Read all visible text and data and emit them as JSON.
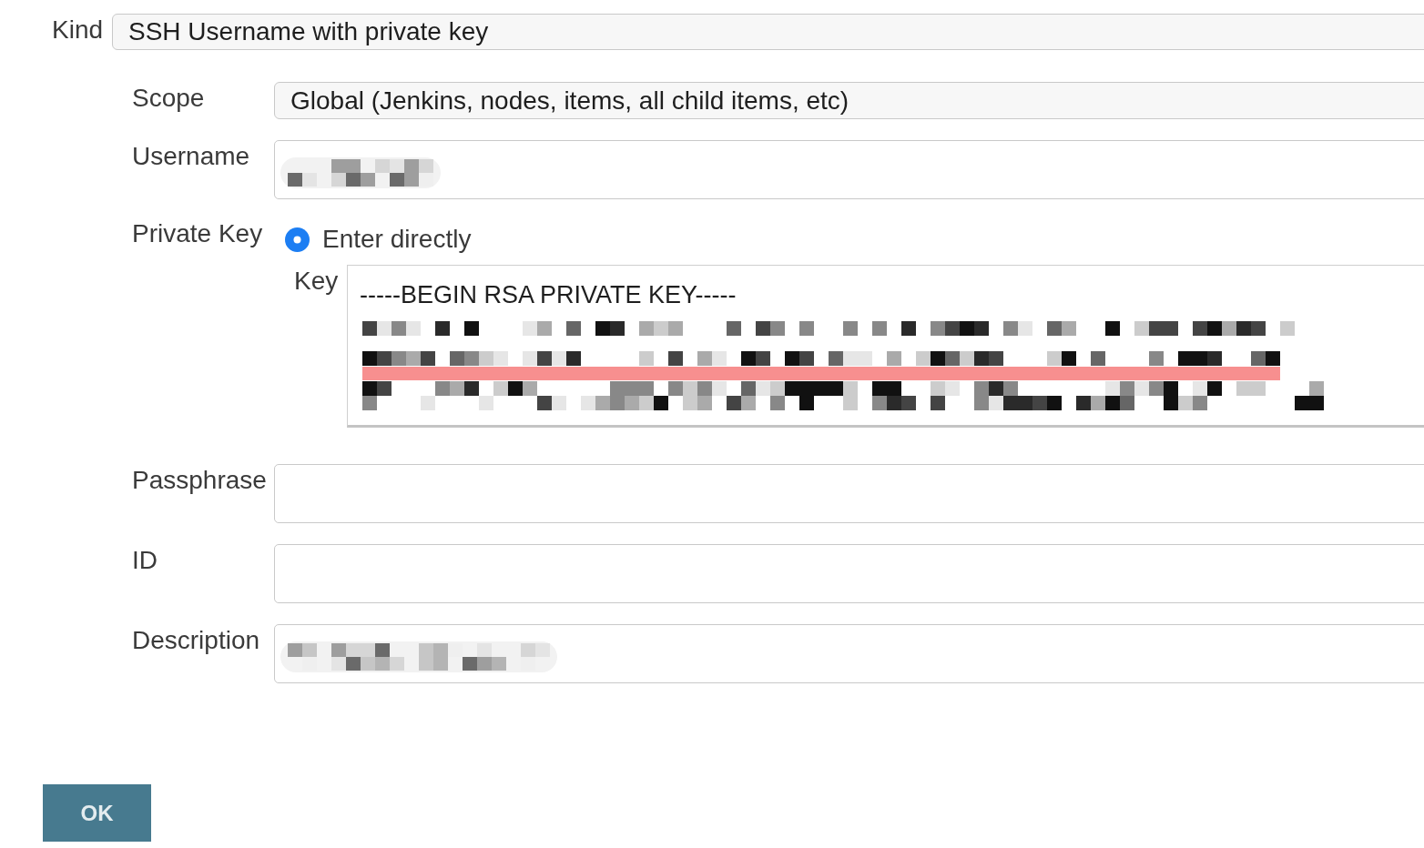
{
  "form": {
    "kind": {
      "label": "Kind",
      "value": "SSH Username with private key"
    },
    "fields": [
      {
        "kind": "select",
        "label": "Scope",
        "value": "Global (Jenkins, nodes, items, all child items, etc)"
      },
      {
        "kind": "text",
        "label": "Username",
        "redacted": true
      },
      {
        "kind": "private_key",
        "label": "Private Key",
        "options": [
          {
            "label": "Enter directly",
            "selected": true
          }
        ],
        "key": {
          "label": "Key",
          "value": "-----BEGIN RSA PRIVATE KEY-----",
          "redacted": true
        }
      },
      {
        "kind": "text",
        "label": "Passphrase"
      },
      {
        "kind": "text",
        "label": "ID"
      },
      {
        "kind": "text",
        "label": "Description",
        "redacted": true
      }
    ]
  },
  "buttons": [
    {
      "label": "OK"
    }
  ]
}
